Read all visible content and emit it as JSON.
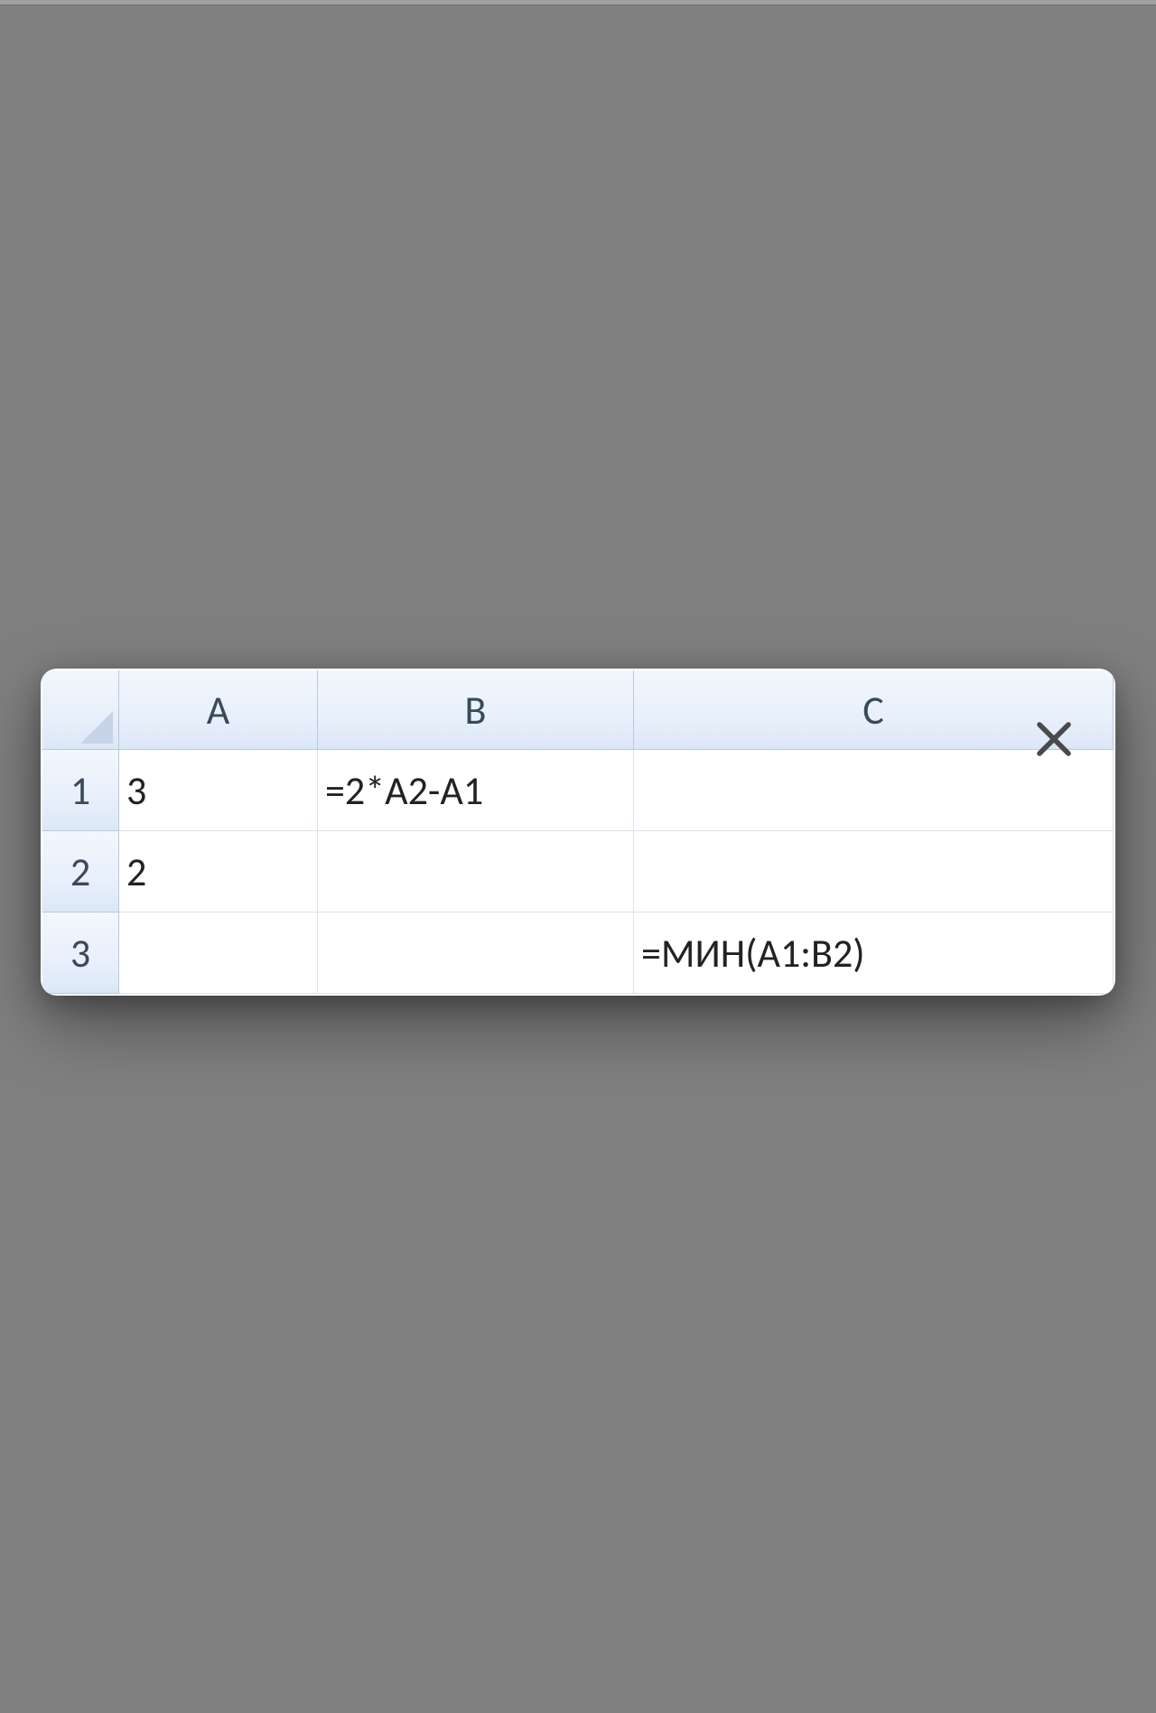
{
  "columns": {
    "A": "A",
    "B": "B",
    "C": "C"
  },
  "rowHeaders": {
    "r1": "1",
    "r2": "2",
    "r3": "3"
  },
  "cells": {
    "A1": "3",
    "B1": "=2*A2-A1",
    "C1": "",
    "A2": "2",
    "B2": "",
    "C2": "",
    "A3": "",
    "B3": "",
    "C3": "=МИН(A1:B2)"
  }
}
